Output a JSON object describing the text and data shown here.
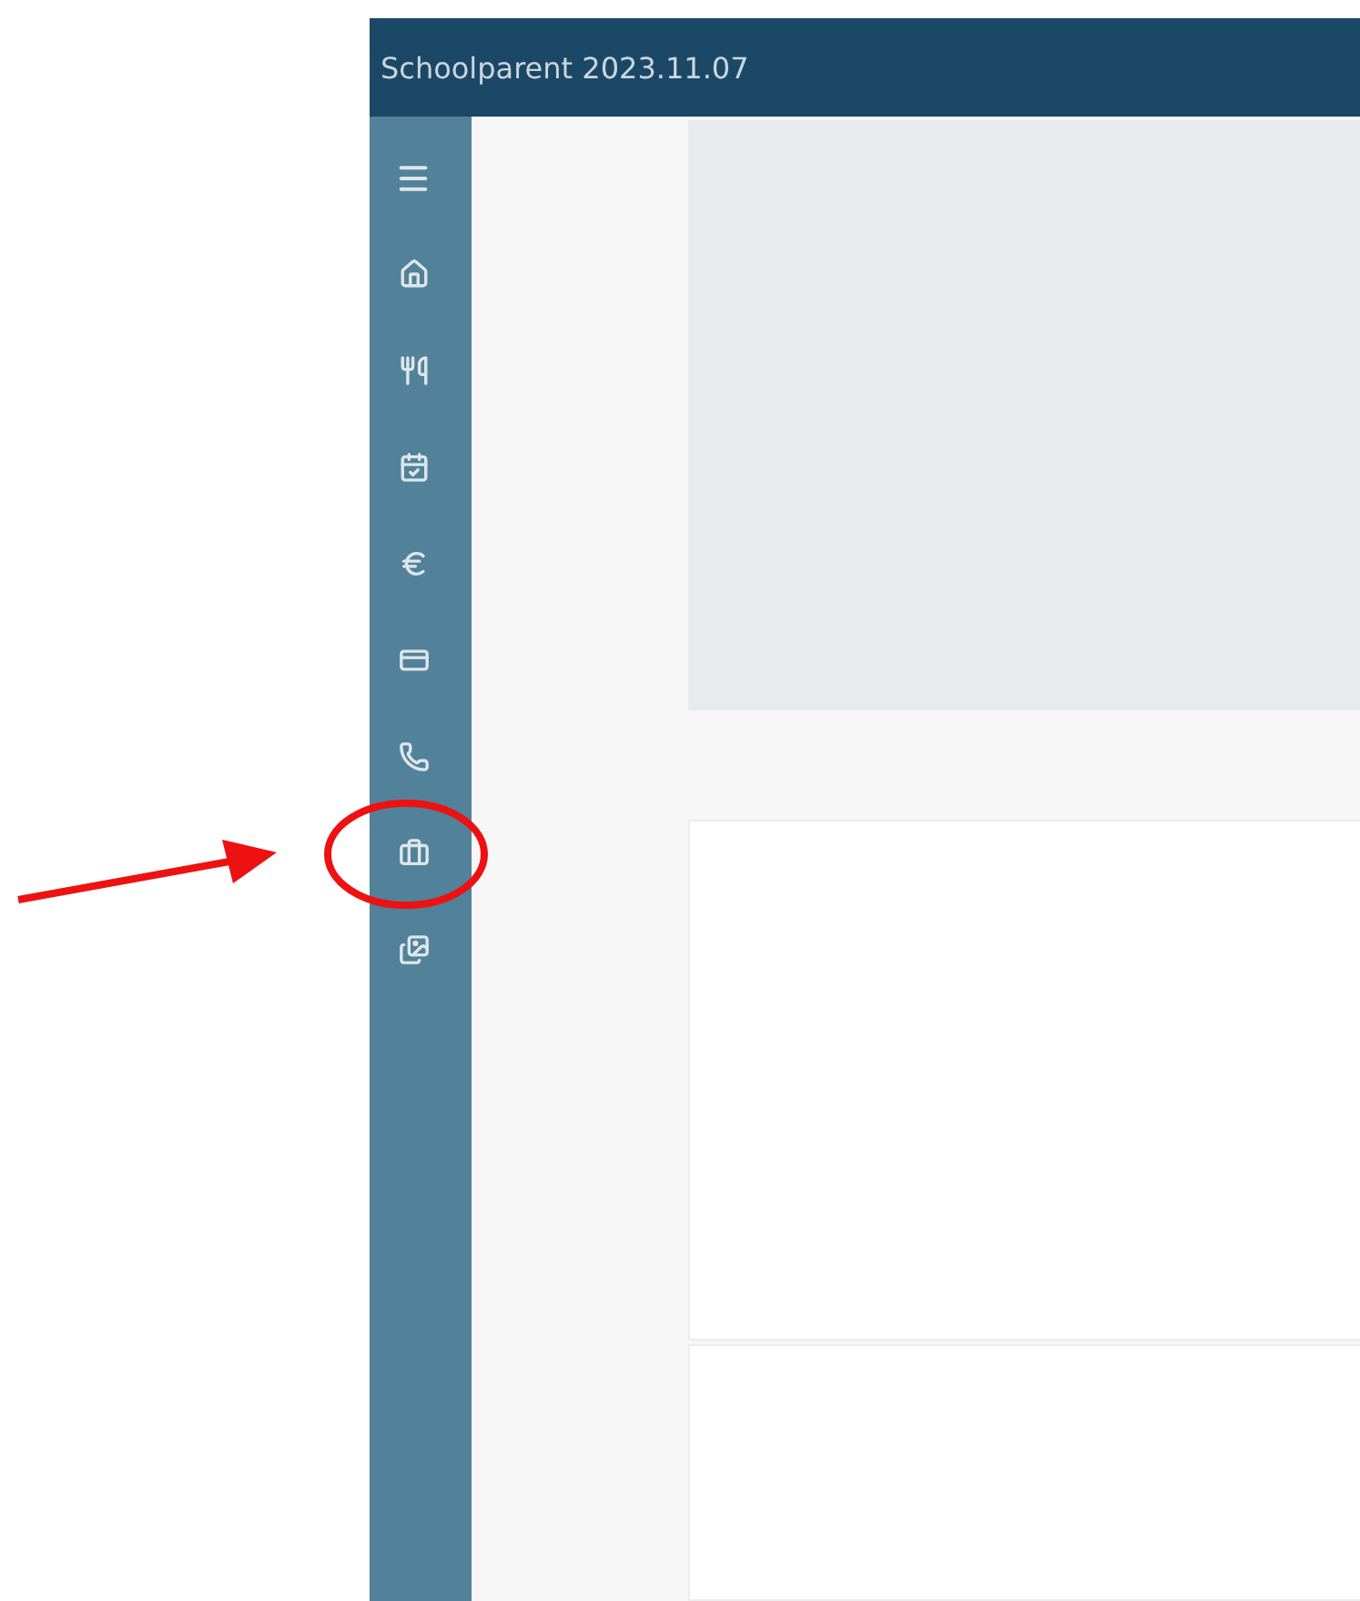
{
  "window": {
    "title": "Schoolparent 2023.11.07"
  },
  "sidebar": {
    "items": [
      {
        "kind": "menu",
        "highlighted": false
      },
      {
        "kind": "home",
        "highlighted": false
      },
      {
        "kind": "meals",
        "highlighted": false
      },
      {
        "kind": "calendar",
        "highlighted": false
      },
      {
        "kind": "euro",
        "highlighted": false
      },
      {
        "kind": "card",
        "highlighted": false
      },
      {
        "kind": "phone",
        "highlighted": false
      },
      {
        "kind": "briefcase",
        "highlighted": true
      },
      {
        "kind": "images",
        "highlighted": false
      }
    ]
  }
}
